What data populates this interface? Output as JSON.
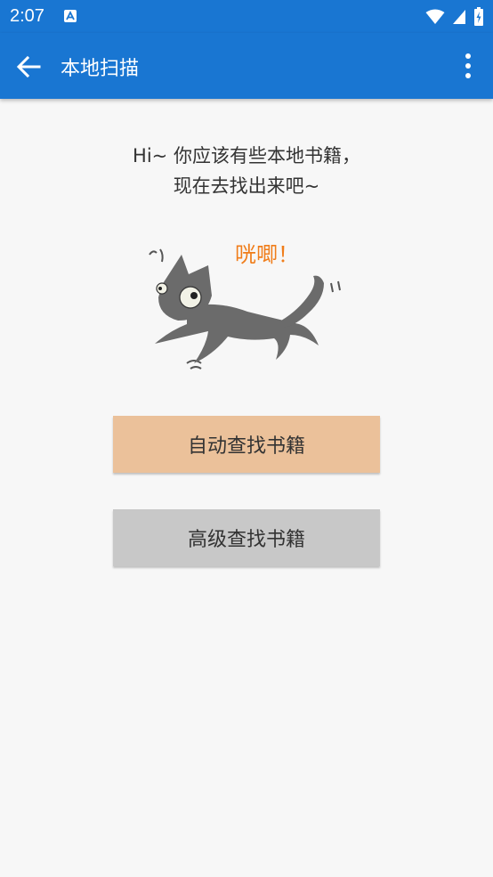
{
  "status_bar": {
    "time": "2:07"
  },
  "app_bar": {
    "title": "本地扫描"
  },
  "intro": {
    "line1": "Hi~ 你应该有些本地书籍，",
    "line2": "现在去找出来吧~"
  },
  "illustration": {
    "exclaim": "咣唧！"
  },
  "buttons": {
    "auto_scan": "自动查找书籍",
    "advanced_scan": "高级查找书籍"
  },
  "colors": {
    "primary": "#1976d2",
    "auto_button_bg": "#ebc19a",
    "advanced_button_bg": "#c8c8c8",
    "cat_gray": "#6b6b6b",
    "exclaim_orange": "#f07d1a"
  }
}
